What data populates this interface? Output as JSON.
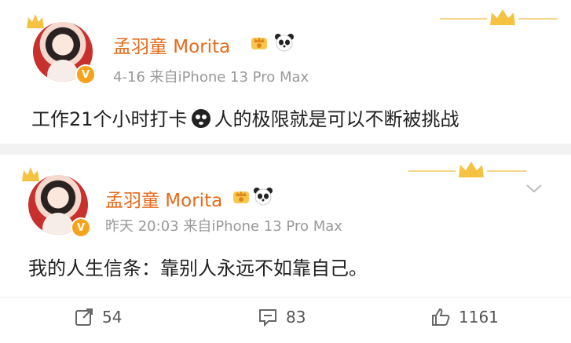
{
  "posts": [
    {
      "author": "孟羽童 Morita",
      "meta": "4-16  来自iPhone 13 Pro Max",
      "body_before": "工作21个小时打卡",
      "body_after": "人的极限就是可以不断被挑战",
      "badges": [
        "crown-badge-icon",
        "panda-emoji-icon"
      ]
    },
    {
      "author": "孟羽童 Morita",
      "meta": "昨天 20:03  来自iPhone 13 Pro Max",
      "body": "我的人生信条：靠别人永远不如靠自己。",
      "badges": [
        "crown-badge-icon",
        "panda-emoji-icon"
      ]
    }
  ],
  "actions": {
    "repost_count": "54",
    "comment_count": "83",
    "like_count": "1161"
  },
  "colors": {
    "name": "#e66a1b",
    "meta": "#999999",
    "separator": "#f2f2f2",
    "crown": "#f5c242"
  }
}
